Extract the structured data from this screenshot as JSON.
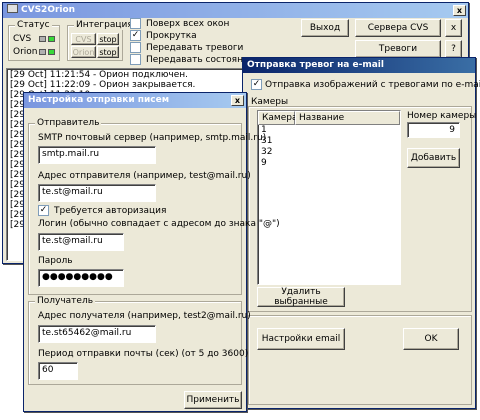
{
  "main": {
    "title": "CVS2Orion",
    "status_group": "Статус",
    "status_cvs": "CVS",
    "status_orion": "Orion",
    "integration_group": "Интеграция",
    "int_cvs_btn": "CVS",
    "int_orion_btn": "Orion",
    "stop1": "stop",
    "stop2": "stop",
    "cb_on_top": "Поверх всех окон",
    "cb_scroll": "Прокрутка",
    "cb_alarms": "Передавать тревоги",
    "cb_state": "Передавать состояние камер",
    "cb_scroll_checked": "✓",
    "exit_btn": "Выход",
    "servers_btn": "Сервера CVS",
    "alarms_btn": "Тревоги",
    "help_btn": "?",
    "close_btn": "x",
    "log": [
      "[29 Oct] 11:21:54 - Орион подключен.",
      "[29 Oct] 11:22:09 - Орион закрывается.",
      "[29 Oct] 11:22:10 -",
      "[29 O",
      "[29 O",
      "[29 O",
      "[29 O",
      "[29 O",
      "[29 O",
      "[29 O",
      "[29 O",
      "[29 O",
      "[29 O",
      "[29 O",
      "[29 O",
      "[29 O"
    ]
  },
  "email_alarm": {
    "title": "Отправка тревог на e-mail",
    "cb_images": "Отправка изображений с тревогами по e-mail",
    "cb_images_checked": "✓",
    "cameras_group": "Камеры",
    "col_camera": "Камера",
    "col_name": "Название",
    "rows": [
      "1",
      "31",
      "32",
      "9"
    ],
    "camera_number_label": "Номер камеры",
    "camera_number_value": "9",
    "add_btn": "Добавить",
    "delete_btn": "Удалить выбранные",
    "settings_btn": "Настройки email",
    "ok_btn": "OK"
  },
  "mail_settings": {
    "title": "Настройка отправки писем",
    "close_btn": "x",
    "sender_group": "Отправитель",
    "smtp_label": "SMTP почтовый сервер (например, smtp.mail.ru)",
    "smtp_value": "smtp.mail.ru",
    "from_label": "Адрес отправителя (например, test@mail.ru)",
    "from_value": "te.st@mail.ru",
    "auth_label": "Требуется авторизация",
    "auth_checked": "✓",
    "login_label": "Логин (обычно совпадает с адресом до знака \"@\")",
    "login_value": "te.st@mail.ru",
    "password_label": "Пароль",
    "password_value": "●●●●●●●●●",
    "recipient_group": "Получатель",
    "to_label": "Адрес получателя (например, test2@mail.ru)",
    "to_value": "te.st65462@mail.ru",
    "period_label": "Период отправки почты (сек) (от 5 до 3600)",
    "period_value": "60",
    "apply_btn": "Применить"
  },
  "colors": {
    "title_active": "#0a246a",
    "title_inactive": "#7a96df",
    "face": "#ece9d8",
    "led_green": "#39d939"
  }
}
